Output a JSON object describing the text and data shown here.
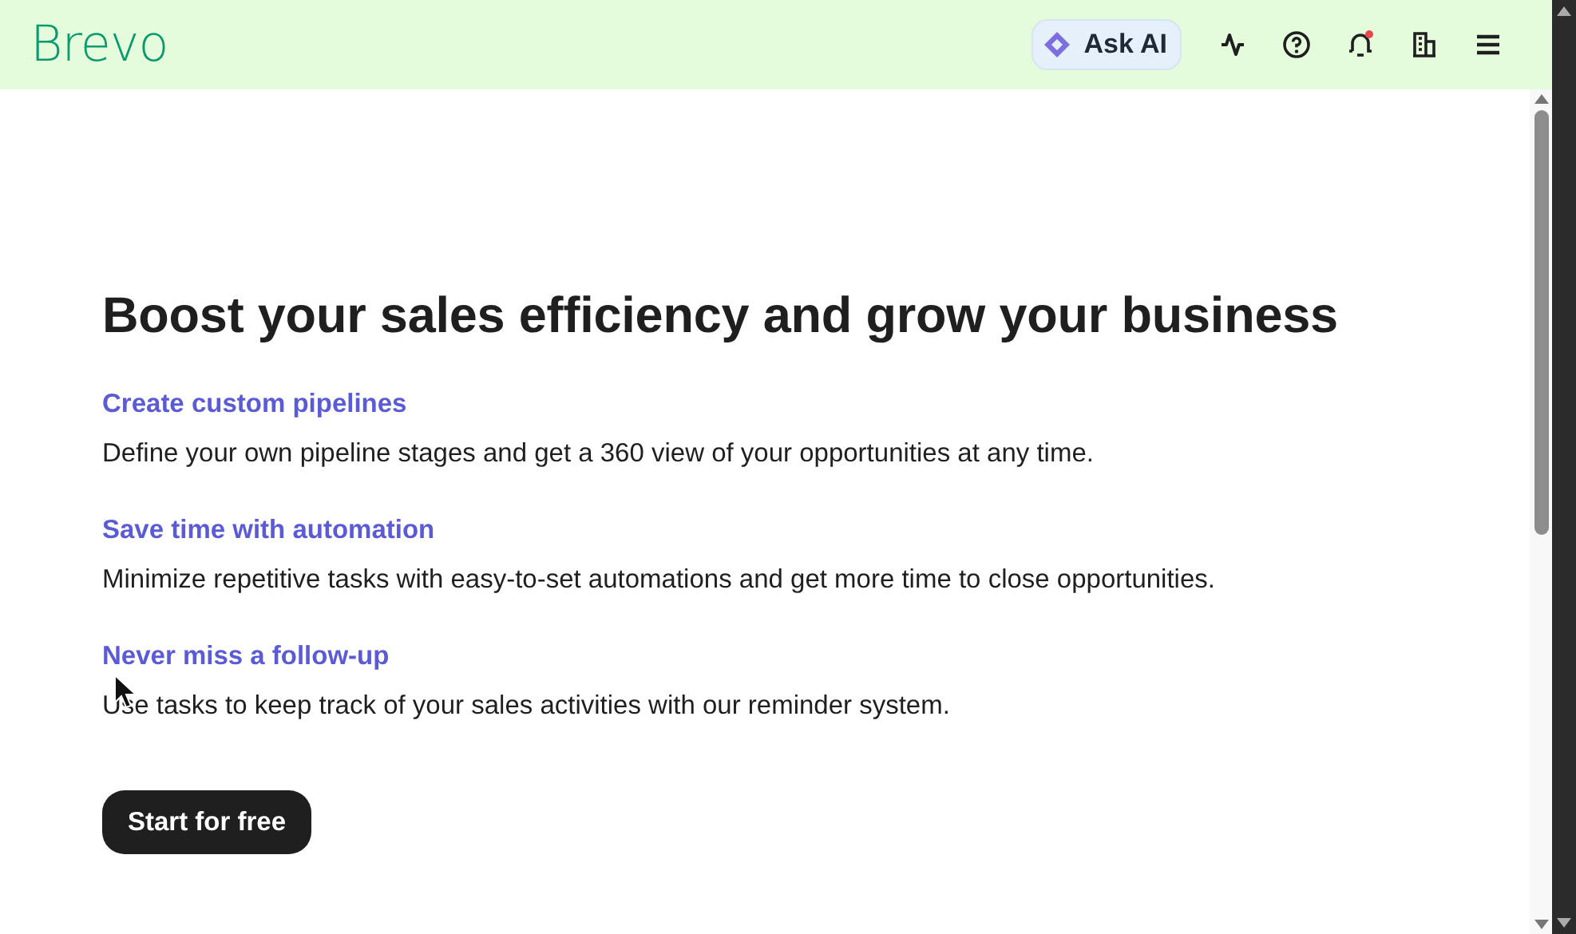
{
  "header": {
    "logo": "Brevo",
    "ask_ai": "Ask AI",
    "notification_unread": true
  },
  "hero": {
    "title": "Boost your sales efficiency and grow your business",
    "features": [
      {
        "title": "Create custom pipelines",
        "description": "Define your own pipeline stages and get a 360 view of your opportunities at any time."
      },
      {
        "title": "Save time with automation",
        "description": "Minimize repetitive tasks with easy-to-set automations and get more time to close opportunities."
      },
      {
        "title": "Never miss a follow-up",
        "description": "Use tasks to keep track of your sales activities with our reminder system."
      }
    ],
    "cta": "Start for free"
  }
}
